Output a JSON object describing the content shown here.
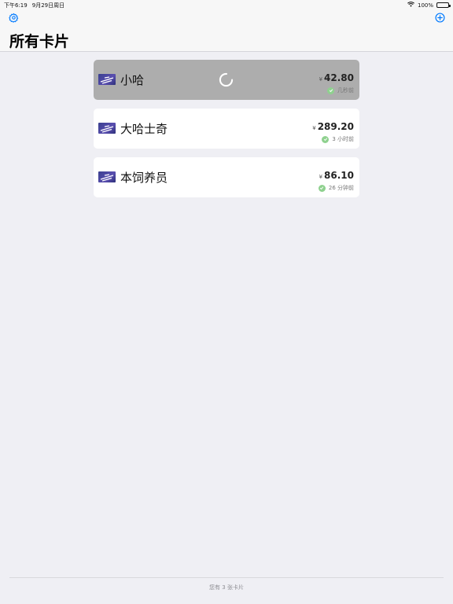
{
  "status_bar": {
    "time": "下午6:19",
    "date": "9月29日周日",
    "battery": "100%",
    "battery_level": 1.0
  },
  "header": {
    "title": "所有卡片",
    "settings_icon": "gear-icon",
    "add_icon": "plus-circle-icon"
  },
  "cards": [
    {
      "name": "小哈",
      "currency": "¥",
      "amount": "42.80",
      "updated": "几秒前",
      "loading": true
    },
    {
      "name": "大哈士奇",
      "currency": "¥",
      "amount": "289.20",
      "updated": "3 小时前",
      "loading": false
    },
    {
      "name": "本饲养员",
      "currency": "¥",
      "amount": "86.10",
      "updated": "26 分钟前",
      "loading": false
    }
  ],
  "footer": {
    "text": "您有 3 张卡片"
  },
  "colors": {
    "accent": "#007aff",
    "success": "#8fd18f",
    "selected_card": "#adadad"
  }
}
